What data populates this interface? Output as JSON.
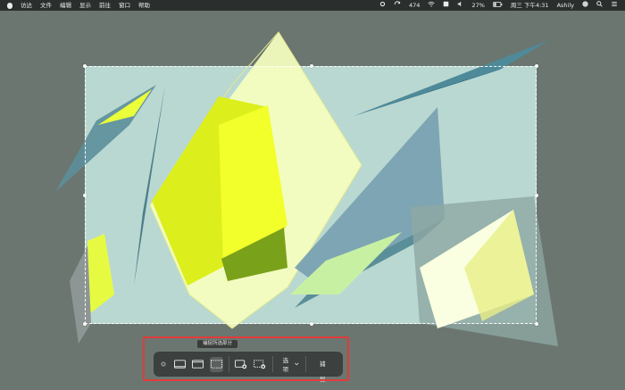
{
  "menubar": {
    "apple_icon": "apple-icon",
    "items": [
      "访达",
      "文件",
      "编辑",
      "显示",
      "前往",
      "窗口",
      "帮助"
    ],
    "right": {
      "battery_temp": "474",
      "battery_percent": "27%",
      "datetime": "周三 下午4:31",
      "user": "Ashily"
    }
  },
  "screenshot_toolbar": {
    "tooltip": "捕捉所选部分",
    "options_label": "选项",
    "capture_label": "捕捉",
    "buttons": [
      {
        "name": "close-icon"
      },
      {
        "name": "capture-entire-screen-icon"
      },
      {
        "name": "capture-window-icon"
      },
      {
        "name": "capture-selected-portion-icon"
      },
      {
        "name": "record-entire-screen-icon"
      },
      {
        "name": "record-selected-portion-icon"
      }
    ]
  },
  "colors": {
    "menubar": "#2a2f2d",
    "wallpaper": "#6b7670",
    "selection_bg": "#b9d8d2",
    "toolbar": "#3c403f",
    "highlight": "#e23b3b",
    "yellow": "#e3f12b"
  }
}
